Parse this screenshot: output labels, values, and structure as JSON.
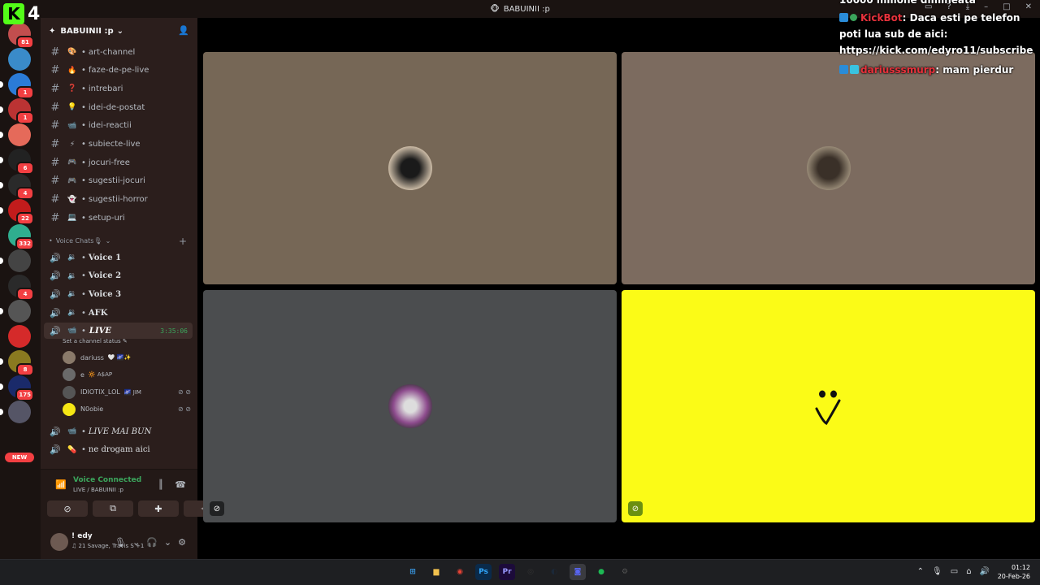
{
  "window": {
    "title": "BABUINII :p"
  },
  "overlay": {
    "kick_count": "4",
    "kick_logo": "K"
  },
  "rail": {
    "servers": [
      {
        "badge": "81"
      },
      {
        "badge": ""
      },
      {
        "badge": "1"
      },
      {
        "badge": "1"
      },
      {
        "badge": ""
      },
      {
        "badge": "6"
      },
      {
        "badge": "4"
      },
      {
        "badge": "22"
      },
      {
        "badge": "332"
      },
      {
        "badge": ""
      },
      {
        "badge": "4"
      },
      {
        "badge": ""
      },
      {
        "badge": ""
      },
      {
        "badge": "8"
      },
      {
        "badge": "175"
      },
      {
        "badge": ""
      }
    ],
    "new_label": "NEW"
  },
  "server": {
    "name": "BABUINII :p"
  },
  "text_channels": [
    {
      "emoji": "🎨",
      "name": "art-channel"
    },
    {
      "emoji": "🔥",
      "name": "faze-de-pe-live"
    },
    {
      "emoji": "❓",
      "name": "intrebari"
    },
    {
      "emoji": "💡",
      "name": "idei-de-postat"
    },
    {
      "emoji": "📹",
      "name": "idei-reactii"
    },
    {
      "emoji": "⚡",
      "name": "subiecte-live"
    },
    {
      "emoji": "🎮",
      "name": "jocuri-free"
    },
    {
      "emoji": "🎮",
      "name": "sugestii-jocuri"
    },
    {
      "emoji": "👻",
      "name": "sugestii-horror"
    },
    {
      "emoji": "💻",
      "name": "setup-uri"
    }
  ],
  "voice_category": "Voice Chats🎙",
  "voice_channels": [
    {
      "name": "Voice 1"
    },
    {
      "name": "Voice 2"
    },
    {
      "name": "Voice 3"
    },
    {
      "name": "AFK"
    }
  ],
  "live_channel": {
    "name": "LIVE",
    "timer": "3:35:06",
    "status": "Set a channel status"
  },
  "live_users": [
    {
      "name": "dariuss",
      "tags": "🤍 🌌✨",
      "color": "#8a7a6a"
    },
    {
      "name": "e",
      "tags": "🔆 A$AP",
      "color": "#6a6a6a"
    },
    {
      "name": "IDIOTIX_LOL",
      "tags": "🌌 JIM",
      "color": "#555555"
    },
    {
      "name": "N0obie",
      "tags": "",
      "color": "#f5e614"
    }
  ],
  "extra_voice": [
    {
      "name": "LIVE MAI BUN"
    },
    {
      "name": "ne drogam aici"
    }
  ],
  "voice_panel": {
    "status": "Voice Connected",
    "sub": "LIVE / BABUINII :p"
  },
  "me": {
    "name": "! edy",
    "activity": "♫ 21 Savage, Travis S +1"
  },
  "chat": {
    "cut_line": "10000 milione dimineata",
    "messages": [
      {
        "user": "KickBot",
        "text": ": Daca esti pe telefon poti lua sub de aici: https://kick.com/edyro11/subscribe"
      },
      {
        "user": "dariusssmurp",
        "text": ": mam pierdur"
      }
    ]
  },
  "taskbar": {
    "apps": [
      {
        "icon": "windows-icon",
        "label": "⊞",
        "color": "#3a9ff0"
      },
      {
        "icon": "folder-icon",
        "label": "▆",
        "color": "#f2c14e"
      },
      {
        "icon": "chrome-icon",
        "label": "◉",
        "color": "#e84335"
      },
      {
        "icon": "photoshop-icon",
        "label": "Ps",
        "color": "#0a2a4a"
      },
      {
        "icon": "premiere-icon",
        "label": "Pr",
        "color": "#1c0b3a"
      },
      {
        "icon": "obs-icon",
        "label": "◎",
        "color": "#333"
      },
      {
        "icon": "steam-icon",
        "label": "◐",
        "color": "#1b2838"
      },
      {
        "icon": "discord-icon",
        "label": "◙",
        "color": "#5865f2"
      },
      {
        "icon": "spotify-icon",
        "label": "●",
        "color": "#1db954"
      },
      {
        "icon": "settings-icon",
        "label": "⚙",
        "color": "#555"
      }
    ],
    "time": "01:12",
    "date": "20-Feb-26"
  },
  "colors": {
    "tile1": "#766756",
    "tile2": "#7c6b5f",
    "tile3": "#4b4d4f",
    "tile4": "#fbfb17"
  }
}
